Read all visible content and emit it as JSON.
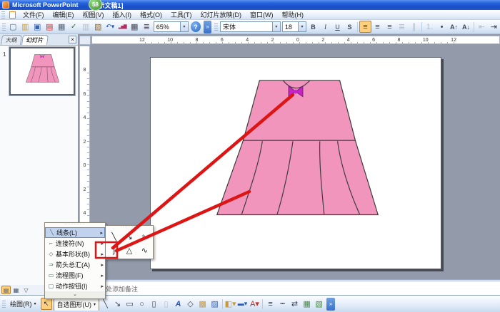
{
  "window": {
    "title_left": "Microsoft PowerPoint",
    "badge": "58",
    "title_right": "示文稿1]"
  },
  "menubar": {
    "items": [
      {
        "name": "menu-file",
        "label": "文件(F)"
      },
      {
        "name": "menu-edit",
        "label": "编辑(E)"
      },
      {
        "name": "menu-view",
        "label": "视图(V)"
      },
      {
        "name": "menu-insert",
        "label": "插入(I)"
      },
      {
        "name": "menu-format",
        "label": "格式(O)"
      },
      {
        "name": "menu-tools",
        "label": "工具(T)"
      },
      {
        "name": "menu-slideshow",
        "label": "幻灯片放映(D)"
      },
      {
        "name": "menu-window",
        "label": "窗口(W)"
      },
      {
        "name": "menu-help",
        "label": "帮助(H)"
      }
    ]
  },
  "standard_toolbar": {
    "icons": [
      {
        "name": "new-file-icon",
        "glyph": "▢",
        "cls": "c-new"
      },
      {
        "name": "open-folder-icon",
        "glyph": "▥",
        "cls": "c-open"
      },
      {
        "name": "save-icon",
        "glyph": "▣",
        "cls": "c-save"
      },
      {
        "name": "permission-icon",
        "glyph": "▤",
        "cls": "c-perm"
      },
      {
        "name": "print-icon",
        "glyph": "▦",
        "cls": "c-print"
      },
      {
        "name": "spelling-icon",
        "glyph": "✓",
        "cls": "c-spell"
      },
      {
        "name": "copy-icon",
        "glyph": "▥",
        "cls": "disabled"
      },
      {
        "name": "paste-icon",
        "glyph": "▧",
        "cls": "c-paste"
      },
      {
        "name": "undo-icon",
        "glyph": "↶▾",
        "cls": "c-undo"
      },
      {
        "name": "insert-chart-icon",
        "glyph": "▂▅▇",
        "cls": "c-chart"
      },
      {
        "name": "insert-table-icon",
        "glyph": "▦",
        "cls": "c-table"
      },
      {
        "name": "gridlines-icon",
        "glyph": "≣",
        "cls": "c-table"
      }
    ],
    "zoom_value": "65%",
    "zoom_caret": "▾",
    "help_glyph": "?",
    "overflow_glyph": "»"
  },
  "format_toolbar": {
    "font_name": "宋体",
    "font_caret": "▾",
    "font_size": "18",
    "size_caret": "▾",
    "icons": [
      {
        "name": "bold-button",
        "glyph": "B",
        "cls": "fw"
      },
      {
        "name": "italic-button",
        "glyph": "I",
        "cls": "it"
      },
      {
        "name": "underline-button",
        "glyph": "U",
        "cls": "un"
      },
      {
        "name": "text-shadow-button",
        "glyph": "S",
        "cls": "fw"
      },
      {
        "name": "separator",
        "glyph": "",
        "cls": "sep",
        "interactable": false
      },
      {
        "name": "align-left-button",
        "glyph": "≡",
        "cls": "active"
      },
      {
        "name": "align-center-button",
        "glyph": "≡",
        "cls": ""
      },
      {
        "name": "align-right-button",
        "glyph": "≡",
        "cls": ""
      },
      {
        "name": "distribute-button",
        "glyph": "≣",
        "cls": "disabled"
      },
      {
        "name": "text-direction-button",
        "glyph": "∥",
        "cls": "disabled"
      },
      {
        "name": "separator",
        "glyph": "",
        "cls": "sep",
        "interactable": false
      },
      {
        "name": "numbering-button",
        "glyph": "1.",
        "cls": "disabled"
      },
      {
        "name": "bullets-button",
        "glyph": "•",
        "cls": ""
      },
      {
        "name": "increase-font-button",
        "glyph": "A↑",
        "cls": "fw"
      },
      {
        "name": "decrease-font-button",
        "glyph": "A↓",
        "cls": "fw"
      },
      {
        "name": "separator",
        "glyph": "",
        "cls": "sep",
        "interactable": false
      },
      {
        "name": "decrease-indent-button",
        "glyph": "⇤",
        "cls": "disabled"
      },
      {
        "name": "increase-indent-button",
        "glyph": "⇥",
        "cls": ""
      }
    ]
  },
  "left_panel": {
    "outline_tab": "大纲",
    "slides_tab": "幻灯片",
    "close_glyph": "✕",
    "slide_number": "1"
  },
  "rulers": {
    "horizontal": [
      {
        "v": "12"
      },
      {
        "v": "10"
      },
      {
        "v": "8"
      },
      {
        "v": "6"
      },
      {
        "v": "4"
      },
      {
        "v": "2"
      },
      {
        "v": "0"
      },
      {
        "v": "2"
      },
      {
        "v": "4"
      },
      {
        "v": "6"
      },
      {
        "v": "8"
      },
      {
        "v": "10"
      },
      {
        "v": "12"
      }
    ],
    "vertical": [
      {
        "v": "8"
      },
      {
        "v": "6"
      },
      {
        "v": "4"
      },
      {
        "v": "2"
      },
      {
        "v": "0"
      },
      {
        "v": "2"
      },
      {
        "v": "4"
      }
    ]
  },
  "notes": {
    "placeholder": "处添加备注"
  },
  "autoshapes_menu": {
    "drag_handle": "···········",
    "items": [
      {
        "name": "menu-item-lines",
        "label": "线条(L)",
        "glyph": "╲",
        "arrow": "▸",
        "cls": "hover"
      },
      {
        "name": "menu-item-connectors",
        "label": "连接符(N)",
        "glyph": "⌐",
        "arrow": "▸",
        "cls": ""
      },
      {
        "name": "menu-item-basic-shapes",
        "label": "基本形状(B)",
        "glyph": "◇",
        "arrow": "▸",
        "cls": ""
      },
      {
        "name": "menu-item-block-arrows",
        "label": "箭头总汇(A)",
        "glyph": "⇒",
        "arrow": "▸",
        "cls": ""
      },
      {
        "name": "menu-item-flowchart",
        "label": "流程图(F)",
        "glyph": "▭",
        "arrow": "▸",
        "cls": ""
      },
      {
        "name": "menu-item-action-buttons",
        "label": "动作按钮(I)",
        "glyph": "▢",
        "arrow": "▸",
        "cls": ""
      }
    ],
    "more_glyph": "⌄"
  },
  "lines_submenu": {
    "drag_handle": "·········",
    "tools": [
      {
        "name": "line-tool",
        "glyph": "╲"
      },
      {
        "name": "arrow-tool",
        "glyph": "↘"
      },
      {
        "name": "double-arrow-tool",
        "glyph": "⇘"
      },
      {
        "name": "curve-tool",
        "glyph": "ʃ"
      },
      {
        "name": "freeform-tool",
        "glyph": "△"
      },
      {
        "name": "scribble-tool",
        "glyph": "∿"
      }
    ]
  },
  "drawing_toolbar": {
    "draw_label": "绘图(R)",
    "draw_caret": "▾",
    "select_glyph": "↖",
    "autoshapes_label": "自选图形(U)",
    "autoshapes_caret": "▾",
    "icons": [
      {
        "name": "line-tool-button",
        "glyph": "╲"
      },
      {
        "name": "arrow-tool-button",
        "glyph": "↘"
      },
      {
        "name": "rectangle-tool-button",
        "glyph": "▭"
      },
      {
        "name": "oval-tool-button",
        "glyph": "○"
      },
      {
        "name": "textbox-tool-button",
        "glyph": "▯"
      },
      {
        "name": "vertical-textbox-tool-button",
        "glyph": "▯",
        "cls": "disabled"
      },
      {
        "name": "wordart-tool-button",
        "glyph": "A",
        "cls": "c-wordart"
      },
      {
        "name": "diagram-tool-button",
        "glyph": "◇",
        "cls": "c-table"
      },
      {
        "name": "clipart-tool-button",
        "glyph": "▩",
        "cls": "c-open"
      },
      {
        "name": "picture-tool-button",
        "glyph": "▨",
        "cls": "c-save"
      },
      {
        "name": "separator",
        "glyph": "",
        "cls": "sep",
        "interactable": false
      },
      {
        "name": "fill-color-button",
        "glyph": "◧▾",
        "cls": "c-open"
      },
      {
        "name": "line-color-button",
        "glyph": "▬▾",
        "cls": "c-undo"
      },
      {
        "name": "font-color-button",
        "glyph": "A▾",
        "cls": "c-perm"
      },
      {
        "name": "separator",
        "glyph": "",
        "cls": "sep",
        "interactable": false
      },
      {
        "name": "line-style-button",
        "glyph": "≡"
      },
      {
        "name": "dash-style-button",
        "glyph": "┅"
      },
      {
        "name": "arrow-style-button",
        "glyph": "⇄"
      },
      {
        "name": "shadow-style-button",
        "glyph": "▦",
        "cls": "c-shadow"
      },
      {
        "name": "threed-style-button",
        "glyph": "▧",
        "cls": "c-3d"
      }
    ],
    "overflow_glyph": "»"
  },
  "view_buttons": [
    {
      "name": "normal-view-button",
      "glyph": "▤",
      "cls": "active"
    },
    {
      "name": "slide-sorter-view-button",
      "glyph": "▦",
      "cls": ""
    },
    {
      "name": "slideshow-view-button",
      "glyph": "▽",
      "cls": ""
    }
  ],
  "colors": {
    "workspace_gray": "#939BAB",
    "dress_pink": "#F295BD",
    "dress_outline": "#3C3C3C",
    "bow_magenta": "#C724C7",
    "annotation_red": "#DD1515",
    "titlebar_blue": "#2663E0",
    "highlight_orange": "#FDCF7E"
  }
}
